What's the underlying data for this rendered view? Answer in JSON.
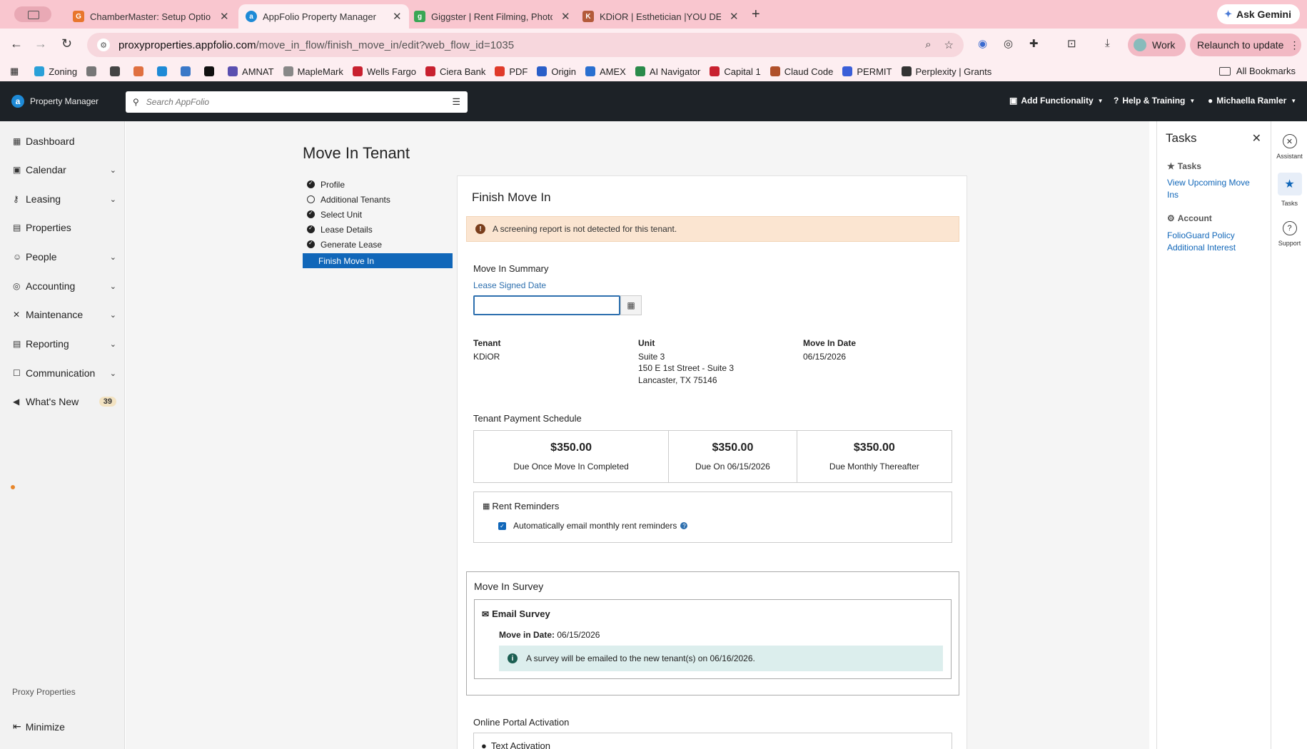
{
  "browser": {
    "tabs": [
      {
        "title": "ChamberMaster: Setup Optio",
        "favicon_color": "#e8762d",
        "favicon_letter": "G"
      },
      {
        "title": "AppFolio Property Manager",
        "favicon_color": "#1e8ad6",
        "favicon_letter": "a"
      },
      {
        "title": "Giggster | Rent Filming, Photo",
        "favicon_color": "#3aa655",
        "favicon_letter": "g"
      },
      {
        "title": "KDiOR | Esthetician |YOU DEF",
        "favicon_color": "#b35a3a",
        "favicon_letter": "K"
      }
    ],
    "ask_gemini": "Ask Gemini",
    "url_host": "proxyproperties.appfolio.com",
    "url_path": "/move_in_flow/finish_move_in/edit?web_flow_id=1035",
    "profile_label": "Work",
    "relaunch_label": "Relaunch to update",
    "bookmarks": [
      {
        "label": "Zoning",
        "color": "#2aa0d8"
      },
      {
        "label": "",
        "color": "#777777"
      },
      {
        "label": "",
        "color": "#444444"
      },
      {
        "label": "",
        "color": "#e07040"
      },
      {
        "label": "",
        "color": "#1e8ad6"
      },
      {
        "label": "",
        "color": "#3a78c8"
      },
      {
        "label": "",
        "color": "#111111"
      },
      {
        "label": "AMNAT",
        "color": "#5a4fb0"
      },
      {
        "label": "MapleMark",
        "color": "#888888"
      },
      {
        "label": "Wells Fargo",
        "color": "#c8202f"
      },
      {
        "label": "Ciera Bank",
        "color": "#c8202f"
      },
      {
        "label": "PDF",
        "color": "#e03a2a"
      },
      {
        "label": "Origin",
        "color": "#2a5ec8"
      },
      {
        "label": "AMEX",
        "color": "#2a6fd0"
      },
      {
        "label": "AI Navigator",
        "color": "#2a8a4a"
      },
      {
        "label": "Capital 1",
        "color": "#c8202f"
      },
      {
        "label": "Claud Code",
        "color": "#b0502a"
      },
      {
        "label": "PERMIT",
        "color": "#3a5ed8"
      },
      {
        "label": "Perplexity | Grants",
        "color": "#333333"
      }
    ],
    "all_bookmarks": "All Bookmarks"
  },
  "header": {
    "logo_text": "Property Manager",
    "search_placeholder": "Search AppFolio",
    "add_functionality": "Add Functionality",
    "help_training": "Help & Training",
    "user_name": "Michaella Ramler"
  },
  "sidebar": {
    "items": [
      {
        "label": "Dashboard"
      },
      {
        "label": "Calendar"
      },
      {
        "label": "Leasing"
      },
      {
        "label": "Properties"
      },
      {
        "label": "People"
      },
      {
        "label": "Accounting"
      },
      {
        "label": "Maintenance"
      },
      {
        "label": "Reporting"
      },
      {
        "label": "Communication"
      },
      {
        "label": "What's New",
        "badge": "39"
      }
    ],
    "company": "Proxy Properties",
    "minimize": "Minimize"
  },
  "page": {
    "title": "Move In Tenant",
    "steps": [
      {
        "label": "Profile",
        "status": "done"
      },
      {
        "label": "Additional Tenants",
        "status": "open"
      },
      {
        "label": "Select Unit",
        "status": "done"
      },
      {
        "label": "Lease Details",
        "status": "done"
      },
      {
        "label": "Generate Lease",
        "status": "done"
      },
      {
        "label": "Finish Move In",
        "status": "active"
      }
    ],
    "card_title": "Finish Move In",
    "alert": "A screening report is not detected for this tenant.",
    "summary_title": "Move In Summary",
    "lease_signed_label": "Lease Signed Date",
    "lease_signed_value": "",
    "tenant_label": "Tenant",
    "tenant_value": "KDiOR",
    "unit_label": "Unit",
    "unit_lines": [
      "Suite 3",
      "150 E 1st Street - Suite 3",
      "Lancaster, TX 75146"
    ],
    "move_in_label": "Move In Date",
    "move_in_value": "06/15/2026",
    "payment_title": "Tenant Payment Schedule",
    "payments": [
      {
        "amount": "$350.00",
        "desc": "Due Once Move In Completed"
      },
      {
        "amount": "$350.00",
        "desc": "Due On 06/15/2026"
      },
      {
        "amount": "$350.00",
        "desc": "Due Monthly Thereafter"
      }
    ],
    "reminders_title": "Rent Reminders",
    "reminders_checkbox": "Automatically email monthly rent reminders",
    "survey_title": "Move In Survey",
    "email_survey": "Email Survey",
    "survey_move_in_label": "Move in Date:",
    "survey_move_in_value": "06/15/2026",
    "survey_info": "A survey will be emailed to the new tenant(s) on 06/16/2026.",
    "portal_title": "Online Portal Activation",
    "text_activation": "Text Activation"
  },
  "tasks_panel": {
    "title": "Tasks",
    "tasks_heading": "Tasks",
    "tasks_link": "View Upcoming Move Ins",
    "account_heading": "Account",
    "account_link": "FolioGuard Policy Additional Interest"
  },
  "rail": {
    "assistant": "Assistant",
    "tasks": "Tasks",
    "support": "Support"
  }
}
